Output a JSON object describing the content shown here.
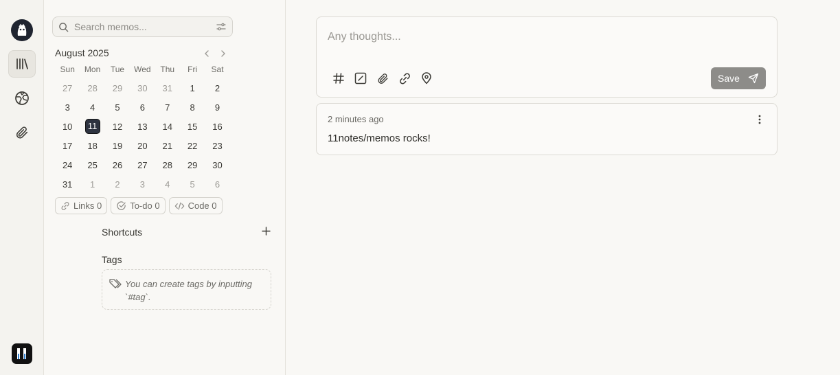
{
  "nav": {
    "items": [
      {
        "name": "memos",
        "icon": "library-icon"
      },
      {
        "name": "explore",
        "icon": "globe-icon"
      },
      {
        "name": "attachments",
        "icon": "paperclip-icon"
      }
    ]
  },
  "search": {
    "placeholder": "Search memos..."
  },
  "calendar": {
    "title": "August 2025",
    "weekdays": [
      "Sun",
      "Mon",
      "Tue",
      "Wed",
      "Thu",
      "Fri",
      "Sat"
    ],
    "weeks": [
      [
        {
          "d": "27",
          "m": true
        },
        {
          "d": "28",
          "m": true
        },
        {
          "d": "29",
          "m": true
        },
        {
          "d": "30",
          "m": true
        },
        {
          "d": "31",
          "m": true
        },
        {
          "d": "1"
        },
        {
          "d": "2"
        }
      ],
      [
        {
          "d": "3"
        },
        {
          "d": "4"
        },
        {
          "d": "5"
        },
        {
          "d": "6"
        },
        {
          "d": "7"
        },
        {
          "d": "8"
        },
        {
          "d": "9"
        }
      ],
      [
        {
          "d": "10"
        },
        {
          "d": "11",
          "today": true
        },
        {
          "d": "12"
        },
        {
          "d": "13"
        },
        {
          "d": "14"
        },
        {
          "d": "15"
        },
        {
          "d": "16"
        }
      ],
      [
        {
          "d": "17"
        },
        {
          "d": "18"
        },
        {
          "d": "19"
        },
        {
          "d": "20"
        },
        {
          "d": "21"
        },
        {
          "d": "22"
        },
        {
          "d": "23"
        }
      ],
      [
        {
          "d": "24"
        },
        {
          "d": "25"
        },
        {
          "d": "26"
        },
        {
          "d": "27"
        },
        {
          "d": "28"
        },
        {
          "d": "29"
        },
        {
          "d": "30"
        }
      ],
      [
        {
          "d": "31"
        },
        {
          "d": "1",
          "m": true
        },
        {
          "d": "2",
          "m": true
        },
        {
          "d": "3",
          "m": true
        },
        {
          "d": "4",
          "m": true
        },
        {
          "d": "5",
          "m": true
        },
        {
          "d": "6",
          "m": true
        }
      ]
    ]
  },
  "stats": {
    "links": "Links 0",
    "todo": "To-do 0",
    "code": "Code 0"
  },
  "shortcuts": {
    "title": "Shortcuts"
  },
  "tags": {
    "title": "Tags",
    "empty_hint": "You can create tags by inputting `#tag`."
  },
  "editor": {
    "placeholder": "Any thoughts...",
    "save_label": "Save"
  },
  "memo": {
    "time": "2 minutes ago",
    "content": "11notes/memos rocks!"
  }
}
